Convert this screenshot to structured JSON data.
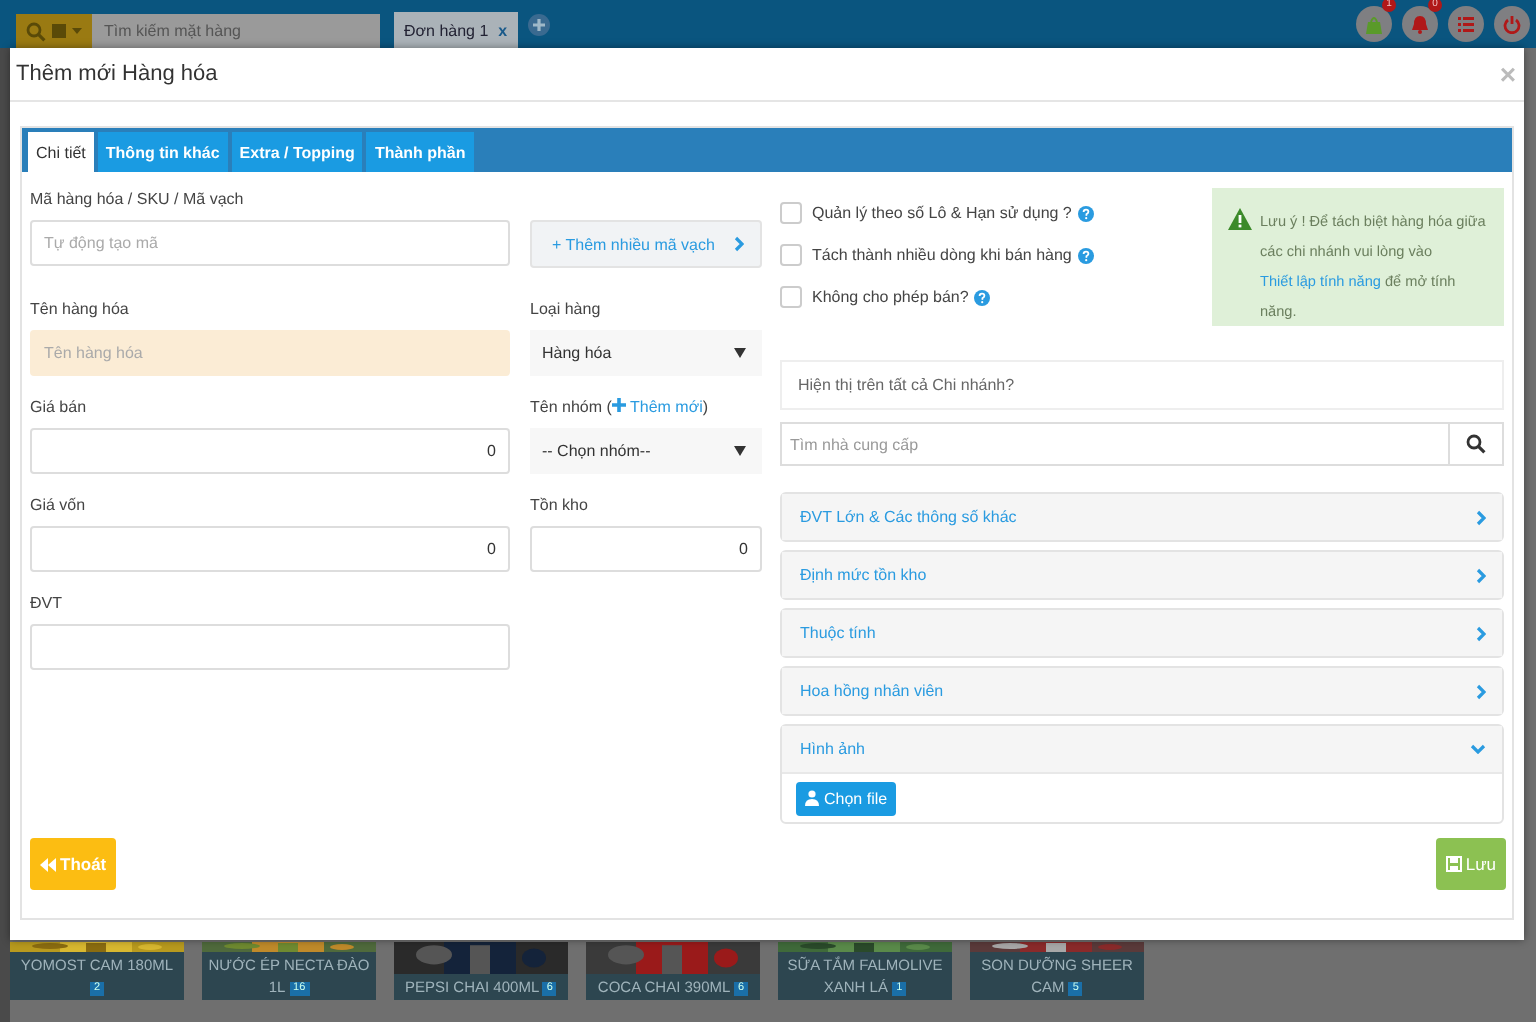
{
  "app": {
    "search_placeholder": "Tìm kiếm mặt hàng",
    "order_tabs": [
      {
        "label": "Đơn hàng 1",
        "close": "x",
        "selected": true
      }
    ],
    "header_icons": [
      {
        "kind": "bag",
        "badge": "1"
      },
      {
        "kind": "bell",
        "badge": "0"
      },
      {
        "kind": "list"
      },
      {
        "kind": "power"
      }
    ],
    "products": [
      {
        "name": "YOMOST CAM 180ML",
        "count": "2"
      },
      {
        "name": "NƯỚC ÉP NECTA ĐÀO 1L",
        "count": "16"
      },
      {
        "name": "PEPSI CHAI 400ML",
        "count": "6"
      },
      {
        "name": "COCA CHAI 390ML",
        "count": "6"
      },
      {
        "name": "SỮA TẮM FALMOLIVE XANH LÁ",
        "count": "1"
      },
      {
        "name": "SON DƯỠNG SHEER CAM",
        "count": "5"
      }
    ]
  },
  "dialog": {
    "title": "Thêm mới Hàng hóa",
    "close": "×",
    "tabs": [
      {
        "label": "Chi tiết",
        "selected": true
      },
      {
        "label": "Thông tin khác",
        "selected": false
      },
      {
        "label": "Extra / Topping",
        "selected": false
      },
      {
        "label": "Thành phần",
        "selected": false
      }
    ],
    "fields": [
      {
        "kind": "text",
        "label": "Mã hàng hóa / SKU / Mã vạch",
        "placeholder": "Tự động tạo mã",
        "highlighted": false
      },
      {
        "kind": "button",
        "label_button": "+ Thêm nhiều mã vạch"
      },
      {
        "kind": "text",
        "label": "Tên hàng hóa",
        "placeholder": "Tên hàng hóa",
        "highlighted": true
      },
      {
        "kind": "select",
        "label": "Loại hàng",
        "value": "Hàng hóa"
      },
      {
        "kind": "number",
        "label": "Giá bán",
        "value": "0",
        "highlighted": false
      },
      {
        "kind": "select",
        "label": "Tên nhóm (",
        "label_link": "Thêm mới",
        "label_end": ")",
        "value": "-- Chọn nhóm--"
      },
      {
        "kind": "number",
        "label": "Giá vốn",
        "value": "0",
        "highlighted": false
      },
      {
        "kind": "number",
        "label": "Tồn kho",
        "value": "0",
        "highlighted": false
      },
      {
        "kind": "text",
        "label": "ĐVT",
        "highlighted": false
      }
    ],
    "options": [
      {
        "label": "Quản lý theo số Lô & Hạn sử dụng ?",
        "checked": false
      },
      {
        "label": "Tách thành nhiều dòng khi bán hàng",
        "checked": false
      },
      {
        "label": "Không cho phép bán?",
        "checked": false
      }
    ],
    "notice": {
      "text_before": "Lưu ý ! Để tách biệt hàng hóa giữa các chi nhánh vui lòng vào",
      "link": "Thiết lập tính năng",
      "text_after": "để mở tính năng."
    },
    "branch_question": "Hiện thị trên tất cả Chi nhánh?",
    "supplier_search": {
      "placeholder": "Tìm nhà cung cấp"
    },
    "sections": [
      {
        "label": "ĐVT Lớn & Các thông số khác",
        "expanded": false
      },
      {
        "label": "Định mức tồn kho",
        "expanded": false
      },
      {
        "label": "Thuộc tính",
        "expanded": false
      },
      {
        "label": "Hoa hồng nhân viên",
        "expanded": false
      },
      {
        "label": "Hình ảnh",
        "expanded": true,
        "upload_button": "Chọn file"
      }
    ],
    "exit_button": "Thoát",
    "save_button": "Lưu"
  }
}
